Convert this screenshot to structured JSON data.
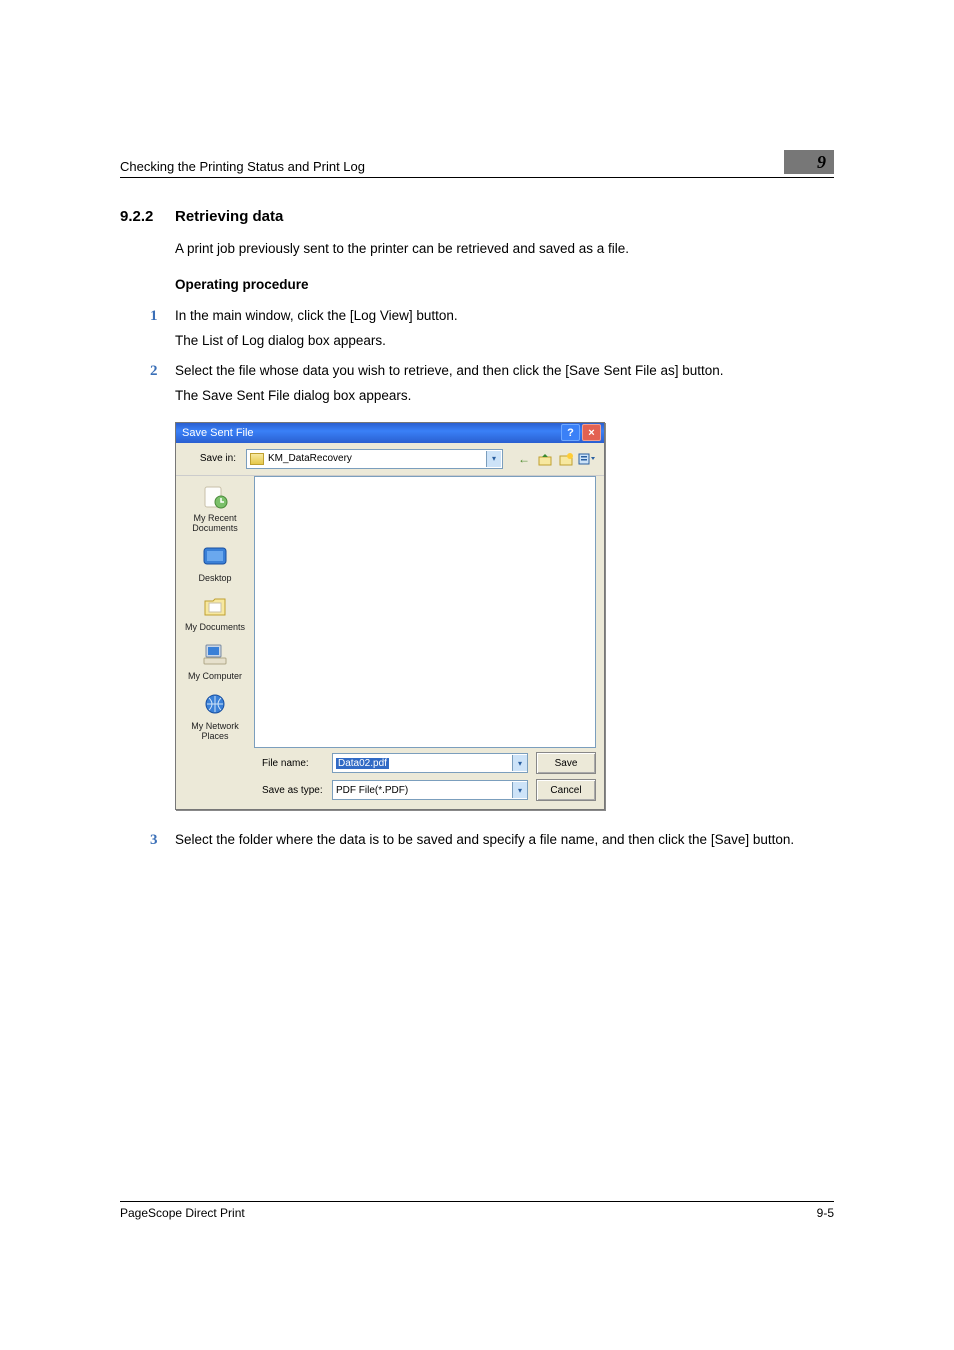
{
  "running_head": {
    "title": "Checking the Printing Status and Print Log",
    "chapter": "9"
  },
  "section": {
    "number": "9.2.2",
    "title": "Retrieving data",
    "intro": "A print job previously sent to the printer can be retrieved and saved as a file."
  },
  "subheading": "Operating procedure",
  "steps": [
    {
      "n": "1",
      "text": "In the main window, click the [Log View] button.",
      "result": "The List of Log dialog box appears."
    },
    {
      "n": "2",
      "text": "Select the file whose data you wish to retrieve, and then click the [Save Sent File as] button.",
      "result": "The Save Sent File dialog box appears."
    },
    {
      "n": "3",
      "text": "Select the folder where the data is to be saved and specify a file name, and then click the [Save] button.",
      "result": ""
    }
  ],
  "dialog": {
    "title": "Save Sent File",
    "savein_label": "Save in:",
    "savein_value": "KM_DataRecovery",
    "toolbar_icons": {
      "back": "←",
      "up": "up-one-level-icon",
      "newfolder": "new-folder-icon",
      "views": "views-icon"
    },
    "places": [
      "My Recent Documents",
      "Desktop",
      "My Documents",
      "My Computer",
      "My Network Places"
    ],
    "filename_label": "File name:",
    "filename_value": "Data02.pdf",
    "filetype_label": "Save as type:",
    "filetype_value": "PDF File(*.PDF)",
    "save_btn": "Save",
    "cancel_btn": "Cancel"
  },
  "footer": {
    "left": "PageScope Direct Print",
    "right": "9-5"
  }
}
